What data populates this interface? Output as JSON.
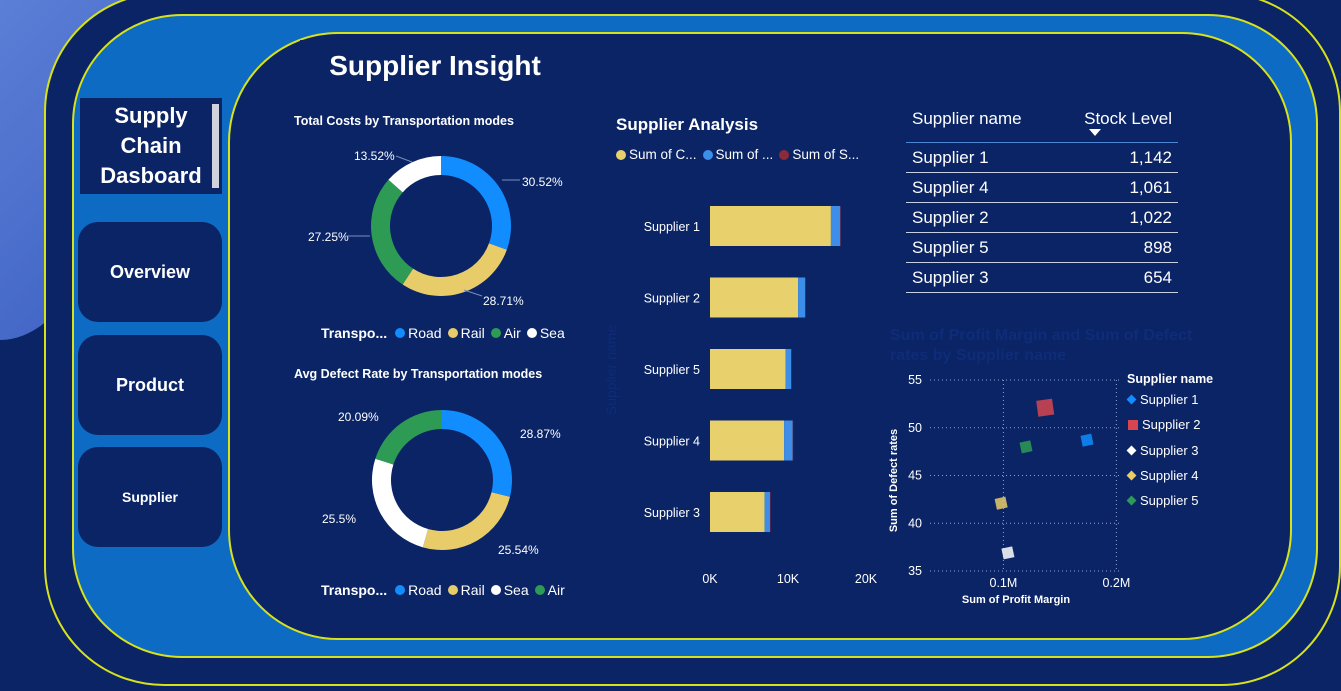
{
  "sidebar": {
    "title": "Supply\nChain\nDasboard",
    "nav": [
      {
        "label": "Overview"
      },
      {
        "label": "Product"
      },
      {
        "label": "Supplier"
      }
    ]
  },
  "page_title": "Supplier Insight",
  "colors": {
    "road": "#118dff",
    "rail": "#e8cc6a",
    "air": "#2e9b54",
    "sea": "#ffffff",
    "bar_a": "#e8d06c",
    "bar_b": "#3d8ee8",
    "legend_c": "#8b2a38",
    "background": "#0a2466",
    "frame": "#0e6bc4",
    "accent_line": "#d8e21a"
  },
  "legend_transport_label": "Transpo...",
  "table": {
    "headers": [
      "Supplier name",
      "Stock Level"
    ],
    "rows": [
      [
        "Supplier 1",
        "1,142"
      ],
      [
        "Supplier 4",
        "1,061"
      ],
      [
        "Supplier 2",
        "1,022"
      ],
      [
        "Supplier 5",
        "898"
      ],
      [
        "Supplier 3",
        "654"
      ]
    ]
  },
  "chart_data": [
    {
      "type": "pie",
      "title": "Total Costs by Transportation modes",
      "categories": [
        "Road",
        "Rail",
        "Air",
        "Sea"
      ],
      "values": [
        30.52,
        28.71,
        27.25,
        13.52
      ],
      "labels": [
        "30.52%",
        "28.71%",
        "27.25%",
        "13.52%"
      ],
      "legend_order": [
        "Road",
        "Rail",
        "Air",
        "Sea"
      ]
    },
    {
      "type": "pie",
      "title": "Avg Defect Rate by Transportation modes",
      "categories": [
        "Road",
        "Rail",
        "Sea",
        "Air"
      ],
      "values": [
        28.87,
        25.54,
        25.5,
        20.09
      ],
      "labels": [
        "28.87%",
        "25.54%",
        "25.5%",
        "20.09%"
      ],
      "legend_order": [
        "Road",
        "Rail",
        "Sea",
        "Air"
      ]
    },
    {
      "type": "bar",
      "title": "Supplier Analysis",
      "ylabel": "Supplier name",
      "categories": [
        "Supplier 1",
        "Supplier 2",
        "Supplier 5",
        "Supplier 4",
        "Supplier 3"
      ],
      "series": [
        {
          "name": "Sum of C...",
          "values": [
            15500,
            11300,
            9700,
            9500,
            7000
          ]
        },
        {
          "name": "Sum of ...",
          "values": [
            1200,
            900,
            700,
            1100,
            700
          ]
        },
        {
          "name": "Sum of S...",
          "values": [
            60,
            50,
            40,
            50,
            40
          ]
        }
      ],
      "x_ticks": [
        "0K",
        "10K",
        "20K"
      ],
      "xlim": [
        0,
        20000
      ]
    },
    {
      "type": "scatter",
      "title": "Sum of Profit Margin and Sum of Defect rates by Supplier name",
      "xlabel": "Sum of Profit Margin",
      "ylabel": "Sum of Defect rates",
      "x_ticks": [
        "0.1M",
        "0.2M"
      ],
      "y_ticks": [
        "35",
        "40",
        "45",
        "50",
        "55"
      ],
      "xlim": [
        0.035,
        0.205
      ],
      "ylim": [
        35,
        55
      ],
      "legend_title": "Supplier name",
      "points": [
        {
          "name": "Supplier 1",
          "x": 0.174,
          "y": 48.7,
          "color": "#118dff"
        },
        {
          "name": "Supplier 2",
          "x": 0.137,
          "y": 52.1,
          "color": "#d64550"
        },
        {
          "name": "Supplier 3",
          "x": 0.104,
          "y": 36.9,
          "color": "#ffffff"
        },
        {
          "name": "Supplier 4",
          "x": 0.098,
          "y": 42.1,
          "color": "#e8cc6a"
        },
        {
          "name": "Supplier 5",
          "x": 0.12,
          "y": 48.0,
          "color": "#2e9b54"
        }
      ]
    }
  ]
}
